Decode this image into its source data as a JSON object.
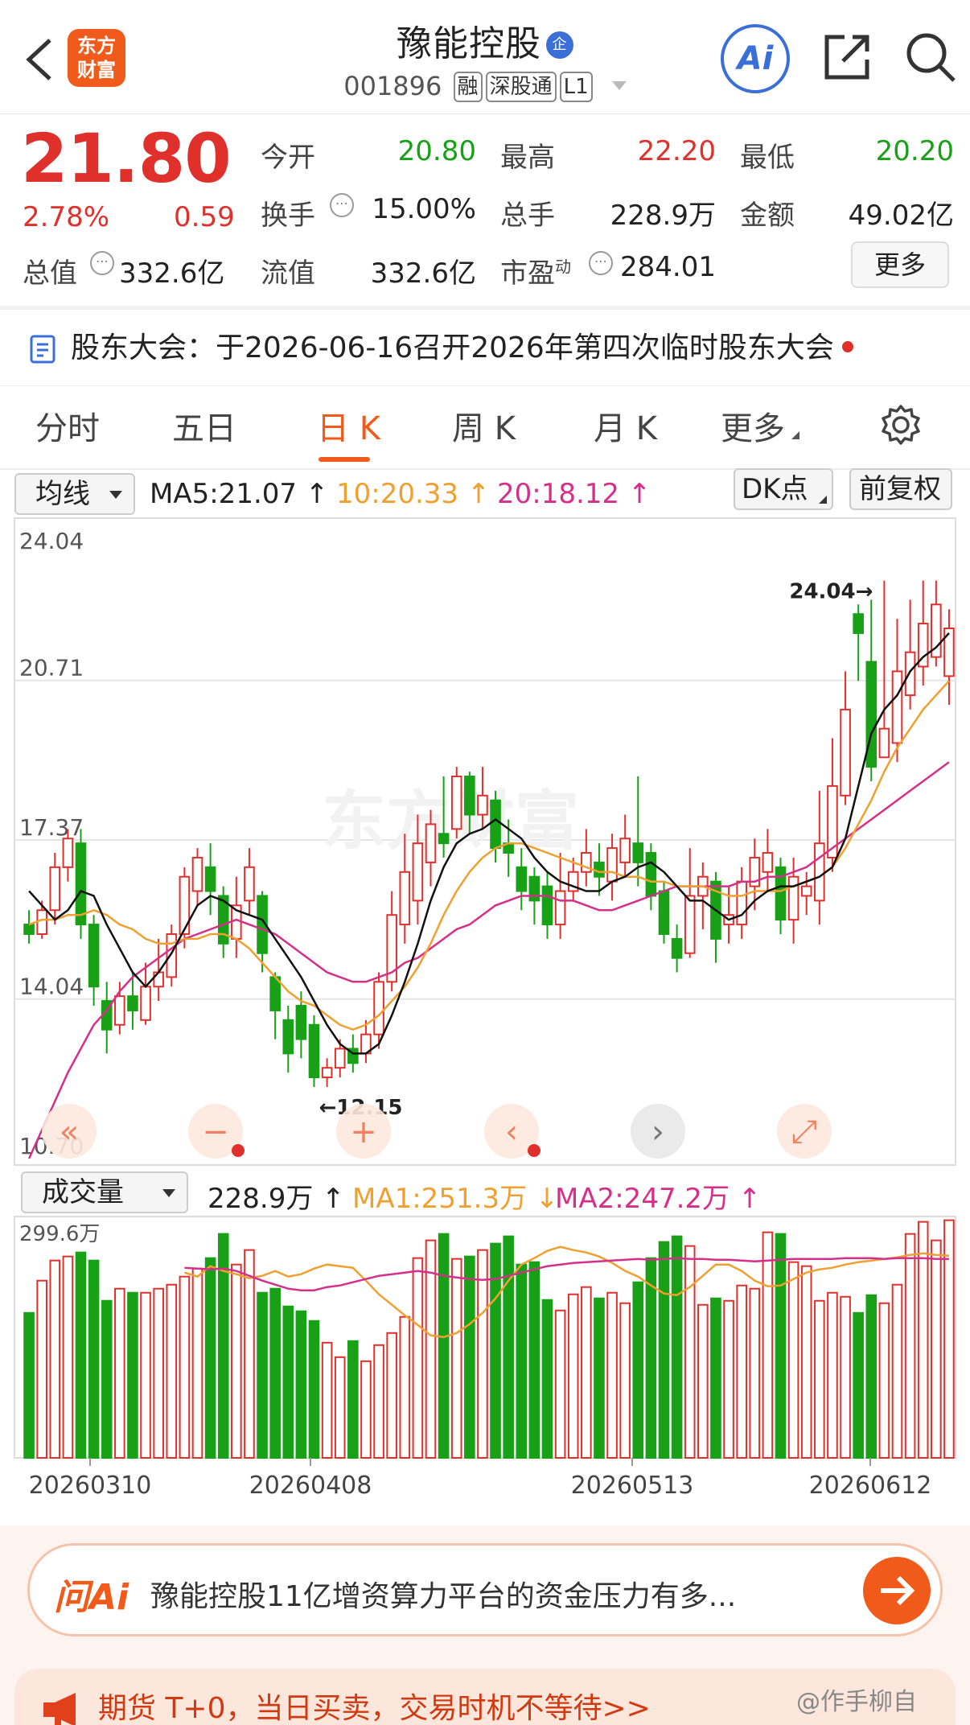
{
  "header": {
    "stock_name": "豫能控股",
    "state_tag": "企",
    "code": "001896",
    "tags": [
      "融",
      "深股通",
      "L1"
    ],
    "logo_text_1": "东方",
    "logo_text_2": "财富",
    "ai_label": "Ai"
  },
  "quote": {
    "price": "21.80",
    "change_pct": "2.78%",
    "change": "0.59",
    "open_label": "今开",
    "open": "20.80",
    "high_label": "最高",
    "high": "22.20",
    "low_label": "最低",
    "low": "20.20",
    "turnover_label": "换手",
    "turnover": "15.00%",
    "volume_label": "总手",
    "volume": "228.9万",
    "amount_label": "金额",
    "amount": "49.02亿",
    "mcap_label": "总值",
    "mcap": "332.6亿",
    "float_label": "流值",
    "float_cap": "332.6亿",
    "pe_label": "市盈",
    "pe_sup": "动",
    "pe": "284.01",
    "more": "更多"
  },
  "notice": "股东大会：于2026-06-16召开2026年第四次临时股东大会",
  "tabs": [
    "分时",
    "五日",
    "日 K",
    "周 K",
    "月 K",
    "更多"
  ],
  "active_tab": "日 K",
  "kline_bar": {
    "selector": "均线",
    "ma5": "MA5:21.07",
    "ma10": "10:20.33",
    "ma20": "20:18.12",
    "dk": "DK点",
    "fq": "前复权"
  },
  "volume_bar": {
    "selector": "成交量",
    "vol": "228.9万",
    "ma1": "MA1:251.3万",
    "ma2": "MA2:247.2万"
  },
  "watermark": "东方财富",
  "colors": {
    "up": "#e0302c",
    "down": "#18a017",
    "ma5": "#111111",
    "ma10": "#f0a030",
    "ma20": "#d4308a",
    "accent": "#f05a1a"
  },
  "chart_data": [
    {
      "type": "candlestick",
      "ylim": [
        10.7,
        24.04
      ],
      "y_ticks": [
        "24.04",
        "20.71",
        "17.37",
        "14.04",
        "10.70"
      ],
      "high_label": "24.04",
      "low_label": "12.15",
      "x_labels": [
        "20260310",
        "20260408",
        "20260513",
        "20260612"
      ],
      "candles": [
        [
          15.6,
          15.4,
          15.9,
          15.2
        ],
        [
          15.4,
          15.9,
          16.1,
          15.3
        ],
        [
          15.9,
          16.8,
          17.1,
          15.6
        ],
        [
          16.8,
          17.4,
          17.6,
          16.5
        ],
        [
          17.3,
          15.6,
          17.6,
          15.3
        ],
        [
          15.6,
          14.3,
          15.8,
          13.9
        ],
        [
          14.0,
          13.4,
          14.4,
          12.9
        ],
        [
          13.5,
          14.1,
          14.4,
          13.3
        ],
        [
          14.1,
          13.8,
          14.6,
          13.4
        ],
        [
          13.6,
          14.3,
          14.8,
          13.5
        ],
        [
          14.3,
          14.6,
          15.3,
          14.0
        ],
        [
          14.5,
          15.4,
          15.6,
          14.3
        ],
        [
          15.4,
          16.6,
          16.8,
          15.1
        ],
        [
          16.3,
          17.0,
          17.2,
          16.0
        ],
        [
          16.8,
          16.3,
          17.3,
          15.8
        ],
        [
          16.2,
          15.2,
          16.4,
          14.9
        ],
        [
          15.3,
          16.0,
          16.6,
          14.9
        ],
        [
          16.1,
          16.8,
          17.2,
          15.8
        ],
        [
          16.2,
          15.0,
          16.3,
          14.6
        ],
        [
          14.5,
          13.8,
          14.6,
          13.2
        ],
        [
          13.6,
          12.9,
          13.9,
          12.5
        ],
        [
          13.9,
          13.2,
          14.2,
          12.8
        ],
        [
          13.5,
          12.4,
          13.7,
          12.2
        ],
        [
          12.4,
          12.6,
          12.8,
          12.2
        ],
        [
          12.6,
          13.0,
          13.2,
          12.4
        ],
        [
          13.0,
          12.7,
          13.3,
          12.5
        ],
        [
          12.9,
          13.3,
          13.6,
          12.7
        ],
        [
          13.3,
          14.4,
          14.6,
          13.0
        ],
        [
          14.4,
          15.8,
          16.3,
          14.2
        ],
        [
          15.6,
          16.7,
          17.5,
          15.2
        ],
        [
          16.1,
          17.3,
          17.9,
          15.6
        ],
        [
          16.9,
          17.7,
          18.0,
          16.4
        ],
        [
          17.5,
          17.3,
          18.7,
          17.0
        ],
        [
          17.6,
          18.7,
          18.9,
          17.4
        ],
        [
          18.7,
          17.9,
          18.8,
          17.5
        ],
        [
          17.9,
          18.3,
          18.9,
          17.6
        ],
        [
          18.2,
          17.2,
          18.4,
          16.9
        ],
        [
          17.3,
          17.1,
          17.8,
          16.6
        ],
        [
          16.8,
          16.3,
          17.2,
          15.9
        ],
        [
          16.6,
          16.1,
          16.8,
          15.6
        ],
        [
          16.4,
          15.6,
          16.7,
          15.3
        ],
        [
          15.6,
          16.3,
          17.1,
          15.3
        ],
        [
          16.3,
          16.7,
          17.0,
          16.1
        ],
        [
          16.7,
          17.1,
          17.6,
          16.4
        ],
        [
          16.9,
          16.6,
          17.3,
          16.2
        ],
        [
          16.5,
          17.2,
          17.5,
          16.1
        ],
        [
          16.9,
          17.4,
          17.9,
          16.6
        ],
        [
          17.3,
          16.9,
          18.7,
          16.4
        ],
        [
          17.1,
          16.2,
          17.3,
          15.9
        ],
        [
          16.3,
          15.4,
          16.5,
          15.2
        ],
        [
          15.3,
          14.9,
          15.6,
          14.6
        ],
        [
          15.0,
          16.2,
          17.2,
          14.9
        ],
        [
          16.2,
          16.6,
          16.9,
          15.5
        ],
        [
          16.5,
          15.3,
          16.7,
          14.8
        ],
        [
          15.6,
          15.8,
          16.4,
          15.2
        ],
        [
          15.6,
          16.5,
          16.8,
          15.3
        ],
        [
          16.4,
          17.0,
          17.4,
          15.9
        ],
        [
          16.7,
          17.1,
          17.6,
          16.3
        ],
        [
          16.8,
          15.7,
          17.0,
          15.4
        ],
        [
          15.7,
          16.6,
          17.0,
          15.2
        ],
        [
          16.2,
          16.4,
          16.7,
          15.8
        ],
        [
          16.1,
          17.3,
          18.4,
          15.6
        ],
        [
          17.0,
          18.5,
          19.5,
          16.7
        ],
        [
          18.3,
          20.1,
          20.9,
          18.1
        ],
        [
          22.1,
          21.7,
          22.3,
          20.7
        ],
        [
          21.1,
          18.9,
          22.4,
          18.6
        ],
        [
          19.1,
          19.7,
          22.8,
          19.3
        ],
        [
          19.4,
          20.9,
          22.0,
          19.0
        ],
        [
          20.4,
          21.3,
          22.4,
          20.1
        ],
        [
          21.0,
          21.9,
          22.8,
          20.6
        ],
        [
          21.2,
          22.3,
          22.8,
          21.0
        ],
        [
          20.8,
          21.8,
          22.2,
          20.2
        ]
      ],
      "ma5": [
        16.3,
        16.0,
        15.7,
        15.9,
        16.3,
        16.2,
        15.6,
        15.1,
        14.6,
        14.3,
        14.6,
        15.0,
        15.5,
        16.0,
        16.2,
        16.1,
        15.9,
        15.8,
        15.7,
        15.3,
        14.9,
        14.5,
        14.0,
        13.5,
        13.1,
        12.9,
        12.9,
        13.1,
        13.7,
        14.4,
        15.2,
        16.1,
        16.8,
        17.3,
        17.5,
        17.6,
        17.8,
        17.6,
        17.4,
        17.0,
        16.7,
        16.5,
        16.4,
        16.3,
        16.3,
        16.5,
        16.6,
        16.8,
        16.9,
        16.7,
        16.4,
        16.1,
        16.1,
        15.9,
        15.7,
        15.8,
        16.1,
        16.3,
        16.4,
        16.4,
        16.5,
        16.6,
        16.8,
        17.4,
        18.5,
        19.6,
        20.1,
        20.4,
        20.9,
        21.2,
        21.4,
        21.7
      ],
      "ma10": [
        15.6,
        15.7,
        15.7,
        15.8,
        15.8,
        15.9,
        15.8,
        15.6,
        15.5,
        15.3,
        15.2,
        15.2,
        15.3,
        15.3,
        15.4,
        15.4,
        15.3,
        15.1,
        14.8,
        14.5,
        14.2,
        14.0,
        13.9,
        13.7,
        13.5,
        13.4,
        13.5,
        13.7,
        14.0,
        14.3,
        14.7,
        15.2,
        15.8,
        16.3,
        16.7,
        17.0,
        17.2,
        17.3,
        17.3,
        17.2,
        17.1,
        17.0,
        16.9,
        16.8,
        16.7,
        16.7,
        16.6,
        16.6,
        16.5,
        16.5,
        16.4,
        16.4,
        16.4,
        16.3,
        16.2,
        16.2,
        16.3,
        16.3,
        16.3,
        16.4,
        16.5,
        16.6,
        16.8,
        17.2,
        17.7,
        18.2,
        18.8,
        19.3,
        19.7,
        20.1,
        20.4,
        20.7
      ],
      "ma20": [
        10.7,
        11.3,
        11.9,
        12.5,
        13.0,
        13.5,
        13.8,
        14.2,
        14.5,
        14.7,
        14.9,
        15.1,
        15.3,
        15.4,
        15.5,
        15.6,
        15.7,
        15.6,
        15.5,
        15.4,
        15.2,
        15.0,
        14.8,
        14.6,
        14.5,
        14.4,
        14.4,
        14.5,
        14.6,
        14.8,
        14.9,
        15.1,
        15.3,
        15.5,
        15.6,
        15.8,
        16.0,
        16.1,
        16.2,
        16.2,
        16.2,
        16.1,
        16.1,
        16.0,
        15.9,
        15.9,
        16.0,
        16.1,
        16.2,
        16.3,
        16.4,
        16.4,
        16.4,
        16.4,
        16.4,
        16.5,
        16.5,
        16.6,
        16.6,
        16.7,
        16.8,
        17.0,
        17.2,
        17.4,
        17.6,
        17.8,
        18.0,
        18.2,
        18.4,
        18.6,
        18.8,
        19.0
      ]
    },
    {
      "type": "bar",
      "ylim": [
        0,
        299.6
      ],
      "y_ticks": [
        "299.6万"
      ],
      "values": [
        180,
        220,
        245,
        250,
        255,
        245,
        195,
        210,
        205,
        205,
        210,
        215,
        225,
        235,
        248,
        278,
        240,
        258,
        205,
        210,
        188,
        182,
        170,
        143,
        125,
        145,
        120,
        140,
        155,
        175,
        248,
        270,
        278,
        247,
        250,
        258,
        266,
        275,
        240,
        243,
        196,
        183,
        203,
        212,
        198,
        205,
        192,
        218,
        248,
        268,
        275,
        263,
        190,
        198,
        195,
        214,
        210,
        280,
        278,
        243,
        238,
        195,
        205,
        200,
        180,
        202,
        192,
        215,
        278,
        293,
        270,
        295
      ],
      "ma1": [
        230,
        225,
        238,
        232,
        228,
        223,
        226,
        232,
        225,
        228,
        235,
        240,
        238,
        236,
        220,
        203,
        190,
        177,
        165,
        152,
        150,
        155,
        166,
        180,
        198,
        220,
        240,
        248,
        257,
        262,
        258,
        255,
        250,
        242,
        232,
        225,
        214,
        204,
        202,
        212,
        226,
        240,
        240,
        232,
        220,
        213,
        214,
        222,
        230,
        234,
        236,
        240,
        243,
        245,
        247,
        249,
        252,
        254,
        252,
        251
      ],
      "ma2": [
        236,
        235,
        234,
        235,
        232,
        226,
        220,
        215,
        210,
        208,
        208,
        212,
        214,
        218,
        222,
        226,
        228,
        230,
        232,
        230,
        226,
        224,
        222,
        221,
        222,
        226,
        230,
        234,
        238,
        240,
        242,
        243,
        244,
        245,
        246,
        247,
        246,
        247,
        248,
        247,
        247,
        246,
        246,
        245,
        244,
        245,
        246,
        247,
        247,
        247,
        247,
        248,
        248,
        248,
        247,
        248,
        248,
        248,
        247,
        247
      ]
    }
  ],
  "ask": {
    "brand": "问Ai",
    "text": "豫能控股11亿增资算力平台的资金压力有多..."
  },
  "promo": "期货 T+0，当日买卖，交易时机不等待>>",
  "footer_watermark": "@作手柳自"
}
